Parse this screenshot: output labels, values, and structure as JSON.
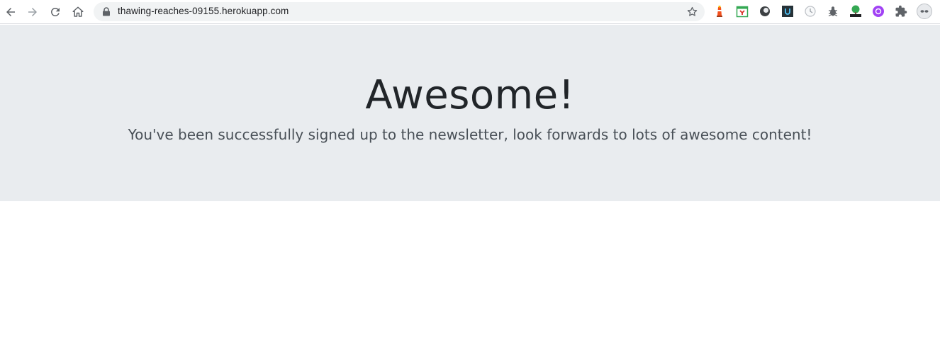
{
  "browser": {
    "url": "thawing-reaches-09155.herokuapp.com",
    "nav_icons": [
      "back-arrow-icon",
      "forward-arrow-icon",
      "reload-icon",
      "home-icon"
    ],
    "extension_icons": [
      "lighthouse-extension-icon",
      "calendar-extension-icon",
      "dark-circle-extension-icon",
      "dark-square-extension-icon",
      "clock-extension-icon",
      "bug-extension-icon",
      "html-tree-extension-icon",
      "purple-circle-extension-icon",
      "puzzle-extensions-icon",
      "profile-avatar-icon"
    ]
  },
  "page": {
    "title": "Awesome!",
    "message": "You've been successfully signed up to the newsletter, look forwards to lots of awesome content!"
  },
  "colors": {
    "jumbotron_bg": "#e9ecef",
    "title": "#212529",
    "message": "#495057"
  }
}
